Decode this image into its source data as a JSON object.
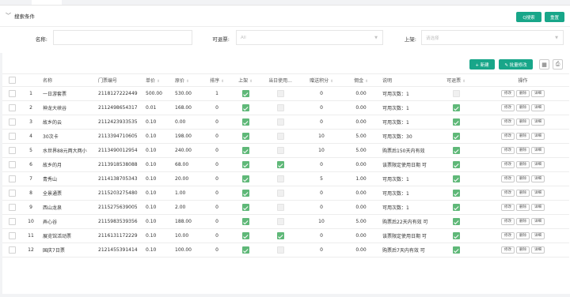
{
  "search": {
    "section_title": "搜索条件",
    "search_label": "Q搜索",
    "reset_label": "重置",
    "fields": {
      "name_label": "名称:",
      "refundable_label": "可退票:",
      "refundable_placeholder": "All",
      "shelf_label": "上架:",
      "shelf_placeholder": "请选择"
    }
  },
  "toolbar": {
    "add_label": "+ 新建",
    "batch_label": "✎ 批量修改"
  },
  "table": {
    "headers": {
      "index": "",
      "name": "名称",
      "code": "门票编号",
      "price": "单价",
      "orig_price": "原价",
      "sort": "排序",
      "shelf": "上架",
      "same_day": "当日使用...",
      "points": "赠送积分",
      "commission": "佣金",
      "desc": "说明",
      "refundable": "可退票",
      "ops": "操作"
    },
    "op_labels": {
      "edit": "修改",
      "delete": "删除",
      "detail": "详细"
    },
    "rows": [
      {
        "idx": "1",
        "name": "一日游套票",
        "code": "2118127222449",
        "price": "500.00",
        "orig": "530.00",
        "sort": "1",
        "shelf": true,
        "same_day": false,
        "points": "0",
        "commission": "0.00",
        "desc": "可用次数：1",
        "refundable": false
      },
      {
        "idx": "2",
        "name": "神龙大峡谷",
        "code": "2112498654317",
        "price": "0.01",
        "orig": "168.00",
        "sort": "0",
        "shelf": true,
        "same_day": false,
        "points": "0",
        "commission": "0.00",
        "desc": "可用次数：1",
        "refundable": true
      },
      {
        "idx": "3",
        "name": "故乡的云",
        "code": "2112423933535",
        "price": "0.10",
        "orig": "0.00",
        "sort": "0",
        "shelf": true,
        "same_day": false,
        "points": "0",
        "commission": "0.00",
        "desc": "可用次数：1",
        "refundable": true
      },
      {
        "idx": "4",
        "name": "30次卡",
        "code": "2113394710605",
        "price": "0.10",
        "orig": "198.00",
        "sort": "0",
        "shelf": true,
        "same_day": false,
        "points": "10",
        "commission": "5.00",
        "desc": "可用次数：30",
        "refundable": true
      },
      {
        "idx": "5",
        "name": "水世界88元两大两小",
        "code": "2113490012954",
        "price": "0.10",
        "orig": "240.00",
        "sort": "0",
        "shelf": true,
        "same_day": false,
        "points": "10",
        "commission": "5.00",
        "desc": "购票后150天内有效",
        "refundable": true
      },
      {
        "idx": "6",
        "name": "故乡的月",
        "code": "2113918538088",
        "price": "0.10",
        "orig": "68.00",
        "sort": "0",
        "shelf": true,
        "same_day": true,
        "points": "0",
        "commission": "0.00",
        "desc": "该票限定使用日期 可",
        "refundable": true
      },
      {
        "idx": "7",
        "name": "青秀山",
        "code": "2114138705343",
        "price": "0.10",
        "orig": "20.00",
        "sort": "0",
        "shelf": true,
        "same_day": false,
        "points": "5",
        "commission": "1.00",
        "desc": "可用次数：1",
        "refundable": true
      },
      {
        "idx": "8",
        "name": "全景通票",
        "code": "2115203275480",
        "price": "0.10",
        "orig": "1.00",
        "sort": "0",
        "shelf": true,
        "same_day": false,
        "points": "0",
        "commission": "0.00",
        "desc": "可用次数：1",
        "refundable": true
      },
      {
        "idx": "9",
        "name": "西山龙泉",
        "code": "2115275639005",
        "price": "0.10",
        "orig": "2.00",
        "sort": "0",
        "shelf": true,
        "same_day": false,
        "points": "0",
        "commission": "0.00",
        "desc": "可用次数：1",
        "refundable": true
      },
      {
        "idx": "10",
        "name": "弄心谷",
        "code": "2115983539356",
        "price": "0.10",
        "orig": "188.00",
        "sort": "0",
        "shelf": true,
        "same_day": false,
        "points": "10",
        "commission": "5.00",
        "desc": "购票后22天内有效 可",
        "refundable": true
      },
      {
        "idx": "11",
        "name": "展览馆活动票",
        "code": "2116131172229",
        "price": "0.10",
        "orig": "10.00",
        "sort": "0",
        "shelf": true,
        "same_day": true,
        "points": "0",
        "commission": "0.00",
        "desc": "该票限定使用日期 可",
        "refundable": true
      },
      {
        "idx": "12",
        "name": "国庆7日票",
        "code": "2121455391414",
        "price": "0.10",
        "orig": "100.00",
        "sort": "0",
        "shelf": true,
        "same_day": false,
        "points": "0",
        "commission": "0.00",
        "desc": "购票后7天内有效 可",
        "refundable": true
      }
    ]
  }
}
